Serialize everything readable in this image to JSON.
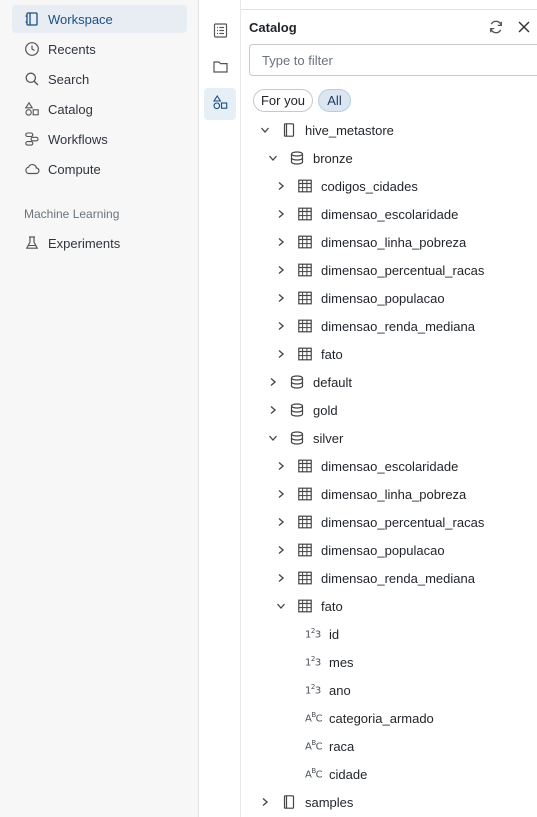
{
  "nav": {
    "items": [
      {
        "label": "Workspace",
        "icon": "workspace-icon",
        "active": true
      },
      {
        "label": "Recents",
        "icon": "clock-icon"
      },
      {
        "label": "Search",
        "icon": "search-icon"
      },
      {
        "label": "Catalog",
        "icon": "catalog-icon"
      },
      {
        "label": "Workflows",
        "icon": "workflows-icon"
      },
      {
        "label": "Compute",
        "icon": "cloud-icon"
      }
    ],
    "section_ml": "Machine Learning",
    "ml_items": [
      {
        "label": "Experiments",
        "icon": "flask-icon"
      }
    ]
  },
  "rail": {
    "buttons": [
      "notebook-outline-icon",
      "folder-icon",
      "shapes-icon"
    ],
    "active_index": 2
  },
  "catalog": {
    "title": "Catalog",
    "filter_placeholder": "Type to filter",
    "chips": [
      "For you",
      "All"
    ],
    "tree": {
      "hive_metastore": "hive_metastore",
      "bronze": {
        "label": "bronze",
        "tables": [
          "codigos_cidades",
          "dimensao_escolaridade",
          "dimensao_linha_pobreza",
          "dimensao_percentual_racas",
          "dimensao_populacao",
          "dimensao_renda_mediana",
          "fato"
        ]
      },
      "default": "default",
      "gold": "gold",
      "silver": {
        "label": "silver",
        "tables": [
          "dimensao_escolaridade",
          "dimensao_linha_pobreza",
          "dimensao_percentual_racas",
          "dimensao_populacao",
          "dimensao_renda_mediana",
          "fato"
        ]
      },
      "fato_columns": [
        {
          "name": "id",
          "type": "numeric"
        },
        {
          "name": "mes",
          "type": "numeric"
        },
        {
          "name": "ano",
          "type": "numeric"
        },
        {
          "name": "categoria_armado",
          "type": "string"
        },
        {
          "name": "raca",
          "type": "string"
        },
        {
          "name": "cidade",
          "type": "string"
        }
      ],
      "samples": "samples"
    }
  },
  "colors": {
    "accent": "#1b4f82",
    "nav_bg": "#f7f7f7",
    "active_bg": "#e8edf3"
  }
}
